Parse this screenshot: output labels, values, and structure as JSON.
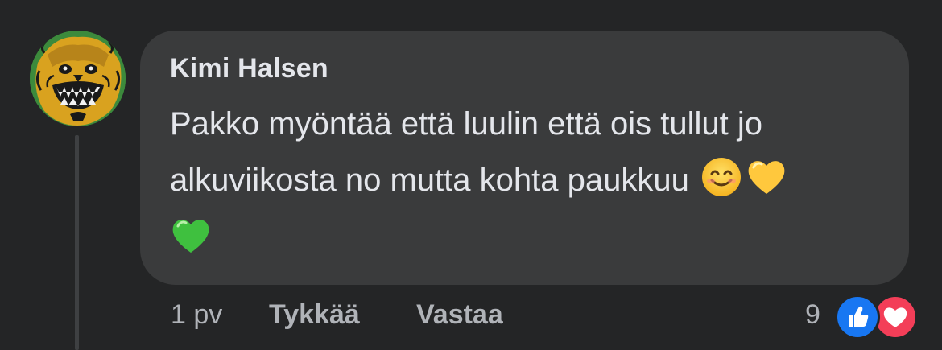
{
  "comment": {
    "author": "Kimi Halsen",
    "text": "Pakko myöntää että luulin että ois tullut jo alkuviikosta no mutta kohta paukkuu",
    "emojis": [
      "smiling-face-icon",
      "yellow-heart-icon",
      "green-heart-icon"
    ],
    "avatar_icon": "lion-crest-avatar"
  },
  "actions": {
    "time": "1 pv",
    "like_label": "Tykkää",
    "reply_label": "Vastaa"
  },
  "reactions": {
    "count": "9",
    "types": [
      "like-icon",
      "love-icon"
    ],
    "colors": {
      "like": "#1877f2",
      "love": "#f33e58"
    }
  },
  "colors": {
    "background": "#242526",
    "bubble": "#3a3b3c",
    "text": "#e4e6eb",
    "secondary_text": "#b0b3b8"
  }
}
